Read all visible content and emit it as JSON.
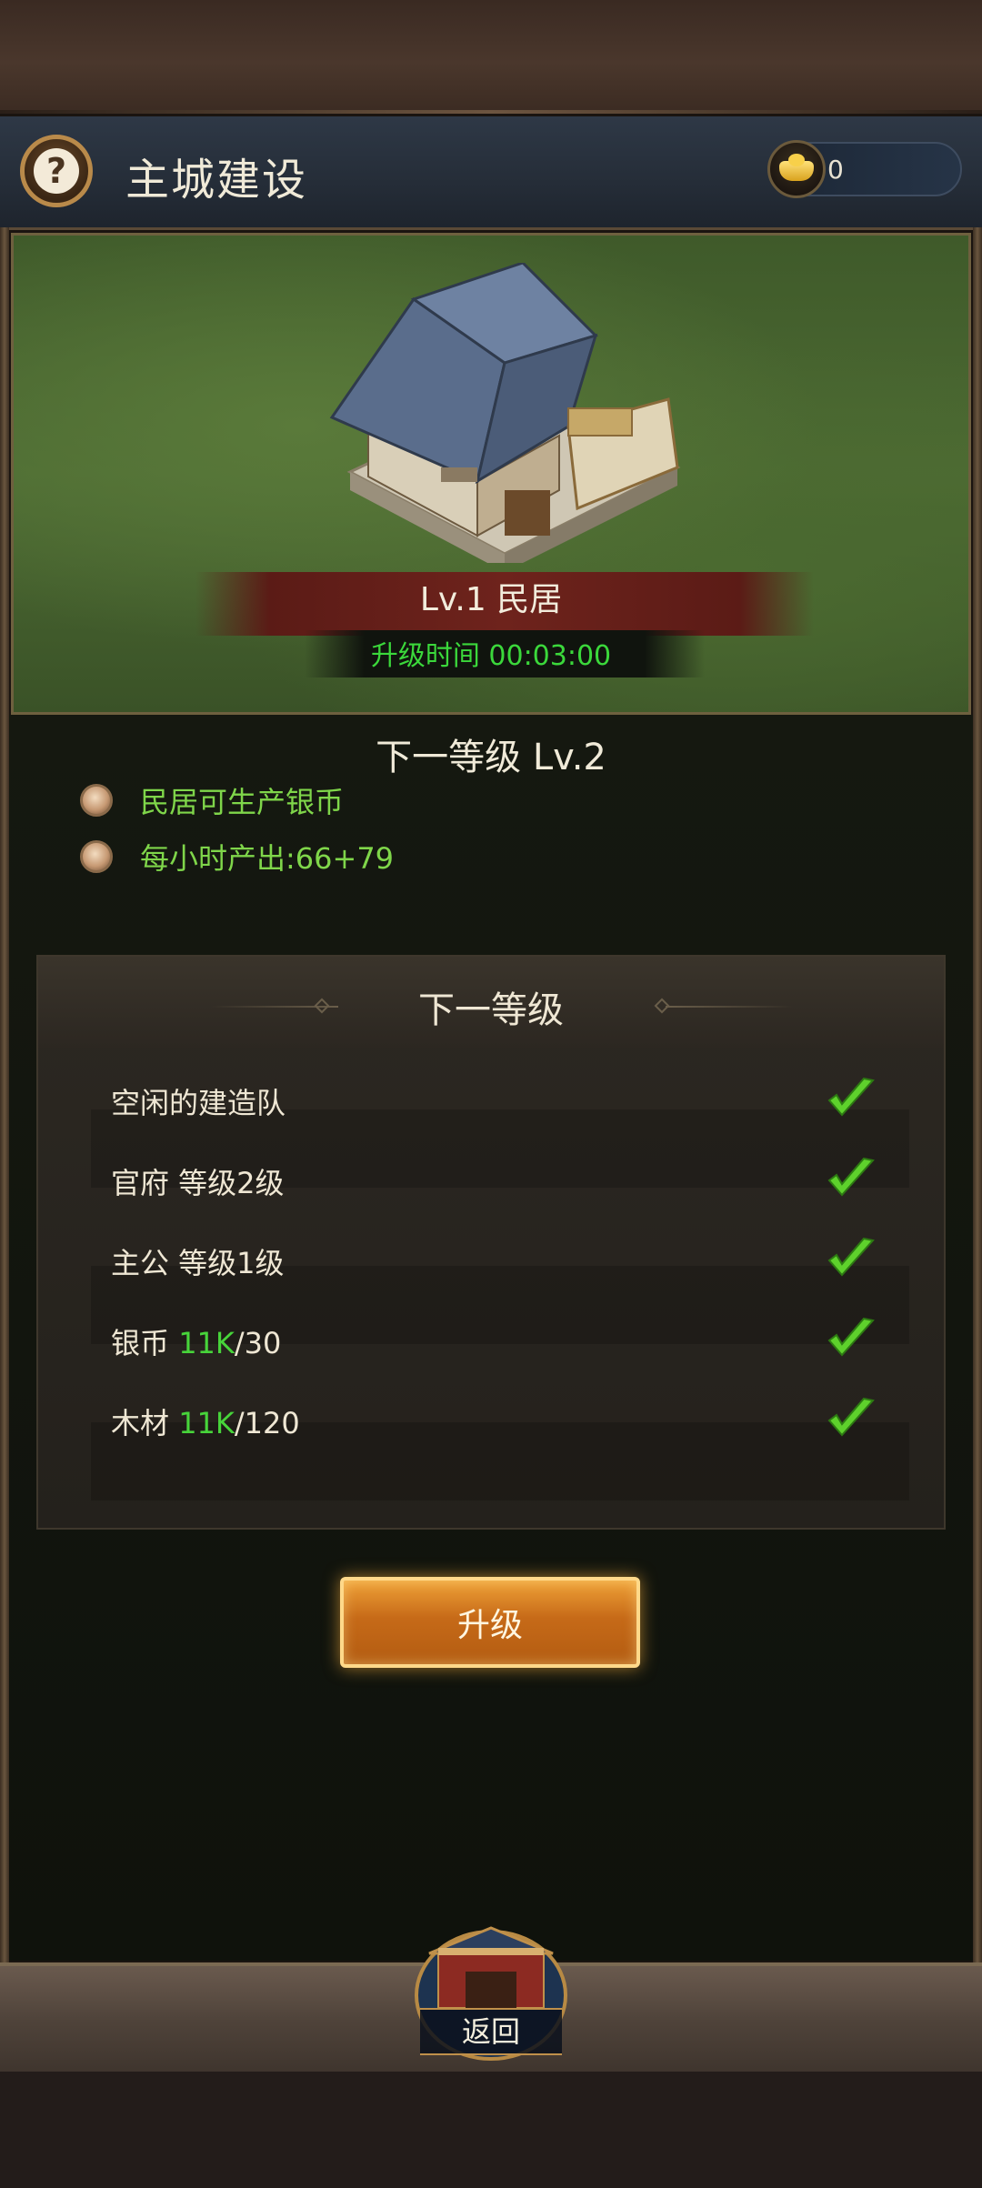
{
  "header": {
    "help_icon": "question-mark-icon",
    "help_glyph": "?",
    "title": "主城建设",
    "gold_icon": "gold-ingot-icon",
    "gold_value": "0"
  },
  "building": {
    "level_name": "Lv.1 民居",
    "upgrade_time": "升级时间 00:03:00"
  },
  "next_level": {
    "title": "下一等级 Lv.2",
    "features": [
      "民居可生产银币",
      "每小时产出:66+79"
    ]
  },
  "requirements": {
    "title": "下一等级",
    "rows": [
      {
        "label": "空闲的建造队",
        "met": true
      },
      {
        "label": "官府 等级2级",
        "met": true
      },
      {
        "label": "主公 等级1级",
        "met": true
      },
      {
        "label_prefix": "银币 ",
        "have": "11K",
        "need": "/30",
        "met": true
      },
      {
        "label_prefix": "木材 ",
        "have": "11K",
        "need": "/120",
        "met": true
      }
    ]
  },
  "actions": {
    "upgrade_label": "升级",
    "back_label": "返回"
  },
  "colors": {
    "accent_green": "#47d43a",
    "button_orange": "#c66a18",
    "text_light": "#efe7d4"
  }
}
